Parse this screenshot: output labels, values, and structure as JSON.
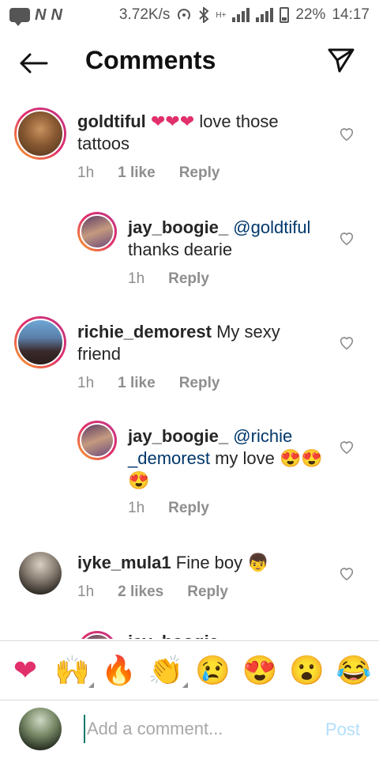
{
  "status_bar": {
    "speed": "3.72K/s",
    "network_label": "H+",
    "battery": "22%",
    "time": "14:17"
  },
  "header": {
    "title": "Comments"
  },
  "comments": [
    {
      "username": "goldtiful",
      "emojis": "❤❤❤",
      "text": "love those tattoos",
      "time": "1h",
      "likes": "1 like",
      "reply": "Reply"
    },
    {
      "username": "jay_boogie_",
      "mention": "@goldtiful",
      "text": "thanks dearie",
      "time": "1h",
      "reply": "Reply"
    },
    {
      "username": "richie_demorest",
      "text": "My sexy friend",
      "time": "1h",
      "likes": "1 like",
      "reply": "Reply"
    },
    {
      "username": "jay_boogie_",
      "mention_1": "@richie",
      "mention_2": "_demorest",
      "text": "my love",
      "emojis": "😍😍😍",
      "time": "1h",
      "reply": "Reply"
    },
    {
      "username": "iyke_mula1",
      "text": "Fine boy",
      "emojis": "👦",
      "time": "1h",
      "likes": "2 likes",
      "reply": "Reply"
    },
    {
      "username": "jay_boogie_"
    }
  ],
  "emoji_bar": [
    "❤",
    "🙌",
    "🔥",
    "👏",
    "😢",
    "😍",
    "😮",
    "😂"
  ],
  "add_comment": {
    "placeholder": "Add a comment...",
    "post_label": "Post"
  }
}
